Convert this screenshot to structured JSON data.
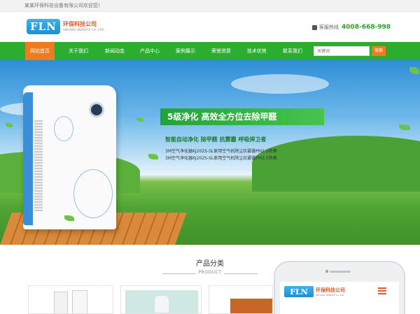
{
  "topbar": {
    "welcome": "某某环保科技设备有限公司欢迎您！"
  },
  "header": {
    "logo_mark": "FLN",
    "logo_cn": "环保科技公司",
    "logo_en": "ANHANG WEBSITE CO.,LTD",
    "hotline_label": "客服热线",
    "hotline_number": "4008-668-998"
  },
  "nav": {
    "items": [
      {
        "label": "网站首页",
        "active": true
      },
      {
        "label": "关于我们"
      },
      {
        "label": "新闻动态"
      },
      {
        "label": "产品中心"
      },
      {
        "label": "案例展示"
      },
      {
        "label": "荣誉资质"
      },
      {
        "label": "技术优势"
      },
      {
        "label": "联系我们"
      }
    ],
    "search_placeholder": "关键词",
    "search_button": "搜索"
  },
  "banner": {
    "headline": "5级净化 高效全方位去除甲醛",
    "tagline": "智能自动净化 除甲醛 抗雾霾 呼吸捍卫者",
    "desc_lines": [
      "3M空气净化器KJ202S-SL家用空气机除尘抗雾霾PM2.5除臭",
      "3M空气净化器KJ202S-SL家用空气机除尘抗雾霾PM2.5除臭"
    ]
  },
  "products": {
    "title": "产品分类",
    "subtitle": "PRODUCT"
  },
  "phone": {
    "logo_mark": "FLN",
    "logo_cn": "环保科技公司",
    "logo_en": "ANHANG WEBSITE CO.,LTD"
  },
  "colors": {
    "nav_green": "#2bae30",
    "accent_orange": "#f07b1f",
    "hotline_green": "#2aa12c",
    "logo_blue": "#1e8fd4"
  }
}
